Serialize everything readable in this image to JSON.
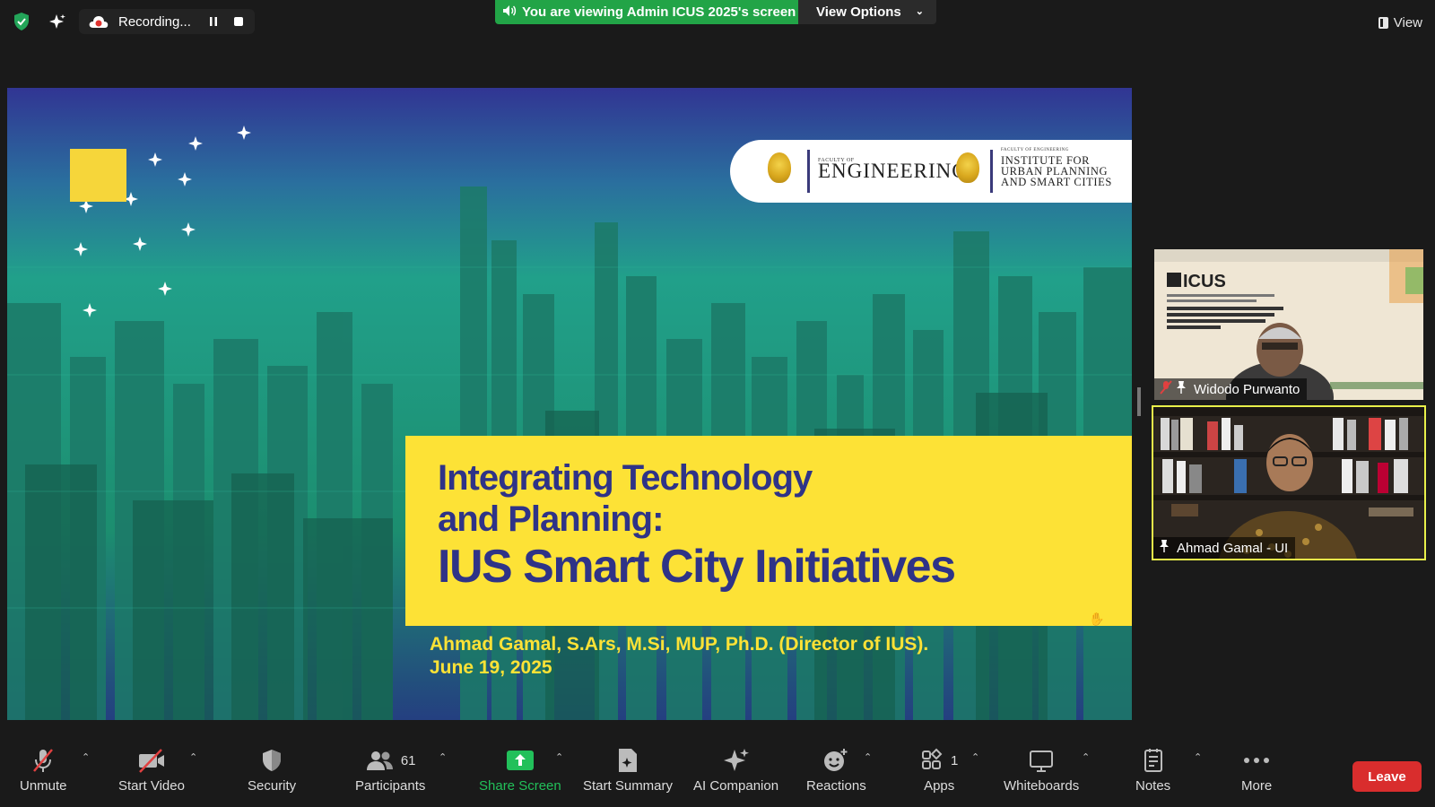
{
  "topbar": {
    "recording_label": "Recording...",
    "viewing_banner": "You are viewing Admin ICUS 2025's screen",
    "view_options": "View Options",
    "view_button": "View"
  },
  "slide": {
    "faculty_small": "FACULTY OF",
    "faculty_name": "ENGINEERING",
    "ius_small": "FACULTY OF ENGINEERING",
    "ius_line1": "INSTITUTE FOR",
    "ius_line2": "URBAN PLANNING",
    "ius_line3": "AND SMART CITIES",
    "title_line1": "Integrating Technology",
    "title_line2": "and Planning:",
    "title_line3": "IUS Smart City Initiatives",
    "author": "Ahmad Gamal, S.Ars, M.Si, MUP, Ph.D. (Director of IUS).",
    "date": "June 19, 2025"
  },
  "participants": [
    {
      "name": "Widodo Purwanto",
      "muted": true,
      "bg_title": "ICUS",
      "bg_subtitle": "\"Advancing Smart Cities, Sustainable Mobility, and Resilient Infrastructure for a Better Future\""
    },
    {
      "name": "Ahmad Gamal - UI",
      "muted": false,
      "active_speaker": true
    }
  ],
  "toolbar": {
    "unmute": "Unmute",
    "start_video": "Start Video",
    "security": "Security",
    "participants": "Participants",
    "participants_count": "61",
    "share_screen": "Share Screen",
    "start_summary": "Start Summary",
    "ai_companion": "AI Companion",
    "reactions": "Reactions",
    "apps": "Apps",
    "apps_count": "1",
    "whiteboards": "Whiteboards",
    "notes": "Notes",
    "more": "More",
    "leave": "Leave"
  },
  "colors": {
    "viewing_banner": "#22a447",
    "slide_yellow": "#fde236",
    "slide_title": "#2f3387",
    "leave_red": "#d92d2d",
    "share_green": "#22c05a",
    "active_speaker_border": "#e8f04a"
  }
}
